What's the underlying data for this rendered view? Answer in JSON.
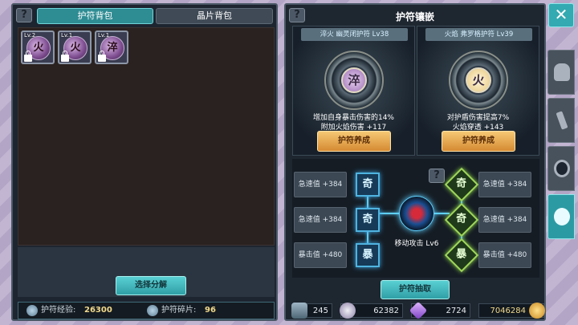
{
  "left": {
    "help": "?",
    "tabs": [
      "护符背包",
      "晶片背包"
    ],
    "items": [
      {
        "level": "Lv.2",
        "glyph": "火"
      },
      {
        "level": "Lv.1",
        "glyph": "火"
      },
      {
        "level": "Lv.1",
        "glyph": "淬"
      }
    ],
    "decompose_button": "选择分解",
    "stats": {
      "exp_label": "护符经验:",
      "exp_value": "26300",
      "shard_label": "护符碎片:",
      "shard_value": "96"
    }
  },
  "right": {
    "help": "?",
    "title": "护符镶嵌",
    "cards": [
      {
        "name": "淬火 幽灵闭护符 Lv38",
        "glyph": "淬",
        "desc1": "增加自身暴击伤害的14%",
        "desc2": "附加火焰伤害 +117",
        "button": "护符养成"
      },
      {
        "name": "火焰 弗罗格护符 Lv39",
        "glyph": "火",
        "desc1": "对护盾伤害提高7%",
        "desc2": "火焰穿透 +143",
        "button": "护符养成"
      }
    ],
    "left_stats": [
      "急速值 +384",
      "急速值 +384",
      "暴击值 +480"
    ],
    "left_sockets": [
      "奇",
      "奇",
      "暴"
    ],
    "right_stats": [
      "急速值 +384",
      "急速值 +384",
      "暴击值 +480"
    ],
    "right_sockets": [
      "奇",
      "奇",
      "暴"
    ],
    "center_label": "移动攻击 Lv6",
    "draw_button": "护符抽取",
    "currencies": [
      "245",
      "62382",
      "2724",
      "7046284"
    ]
  },
  "close": "✕",
  "side_tabs": [
    "helmet-icon",
    "weapons-icon",
    "target-icon",
    "amulet-icon"
  ],
  "colors": {
    "accent": "#2e8c93",
    "gold": "#f2d98a",
    "orange": "#d58a32"
  }
}
